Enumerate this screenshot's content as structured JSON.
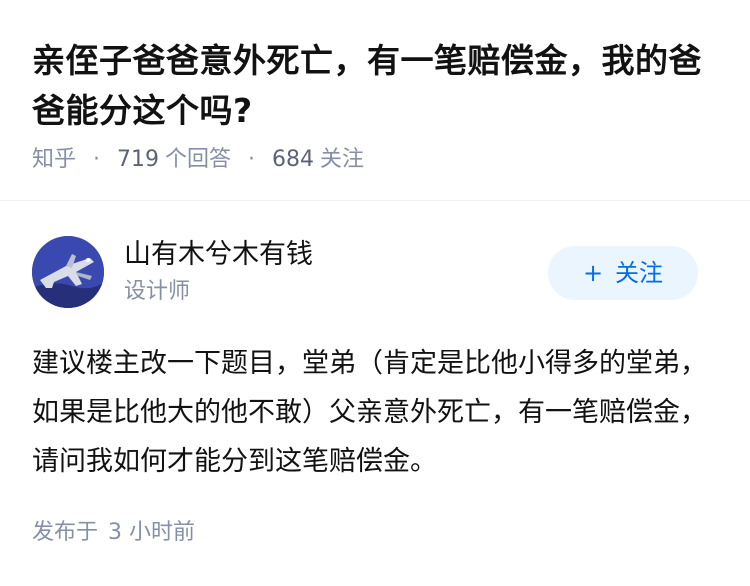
{
  "question": {
    "title": "亲侄子爸爸意外死亡，有一笔赔偿金，我的爸爸能分这个吗?",
    "source": "知乎",
    "separator": "·",
    "answer_count": "719",
    "answer_label": "个回答",
    "follower_count": "684",
    "follower_label": "关注"
  },
  "answer": {
    "author": {
      "name": "山有木兮木有钱",
      "bio": "设计师",
      "avatar_icon": "avatar-jet-fighter"
    },
    "follow_button": {
      "icon": "+",
      "label": "关注"
    },
    "content": "建议楼主改一下题目，堂弟（肯定是比他小得多的堂弟，如果是比他大的他不敢）父亲意外死亡，有一笔赔偿金，请问我如何才能分到这笔赔偿金。",
    "published": {
      "label": "发布于",
      "time": "3 小时前"
    }
  },
  "colors": {
    "text_primary": "#121212",
    "text_secondary": "#8590a6",
    "accent_blue": "#056de8",
    "follow_bg": "#ebf5fd",
    "divider": "#f0f2f7"
  }
}
